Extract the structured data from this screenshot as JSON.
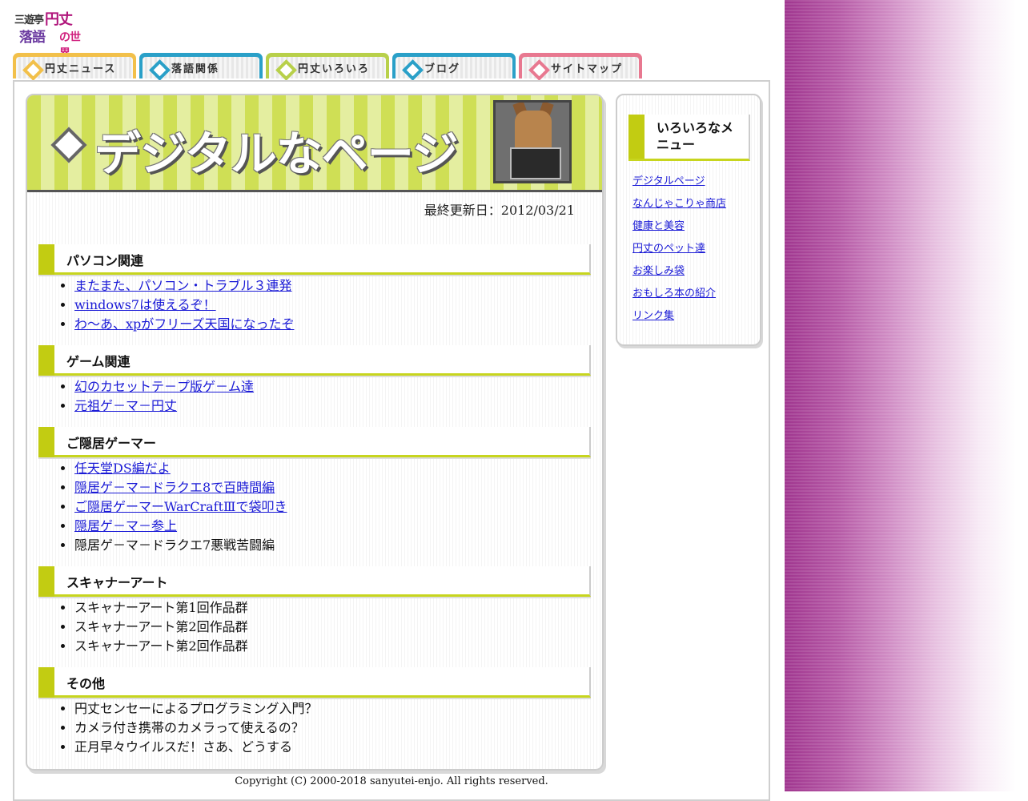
{
  "logo": {
    "line1a": "三遊亭",
    "line1b": "円丈",
    "line2a": "落語",
    "line2b": "の世界"
  },
  "nav": {
    "tabs": [
      {
        "label": "円丈ニュース",
        "color": "#f2c04a"
      },
      {
        "label": "落語関係",
        "color": "#2aa0c8"
      },
      {
        "label": "円丈いろいろ",
        "color": "#b8d04a"
      },
      {
        "label": "ブログ",
        "color": "#2aa0c8"
      },
      {
        "label": "サイトマップ",
        "color": "#e87890"
      }
    ]
  },
  "banner": {
    "title": "デジタルなページ"
  },
  "updated": "最終更新日：2012/03/21",
  "sections": [
    {
      "title": "パソコン関連",
      "items": [
        {
          "text": "またまた、パソコン・トラブル３連発",
          "link": true
        },
        {
          "text": "windows7は使えるぞ！",
          "link": true
        },
        {
          "text": "わ～あ、xpがフリーズ天国になったぞ",
          "link": true
        }
      ]
    },
    {
      "title": "ゲーム関連",
      "items": [
        {
          "text": "幻のカセットテ－プ版ゲ－ム達",
          "link": true
        },
        {
          "text": "元祖ゲ－マ－円丈",
          "link": true
        }
      ]
    },
    {
      "title": "ご隠居ゲーマー",
      "items": [
        {
          "text": "任天堂DS編だよ",
          "link": true
        },
        {
          "text": "隠居ゲ－マ－ドラクエ8で百時間編",
          "link": true
        },
        {
          "text": "ご隠居ゲーマーWarCraftⅢで袋叩き",
          "link": true
        },
        {
          "text": "隠居ゲ－マ－参上",
          "link": true
        },
        {
          "text": "隠居ゲ－マ－ドラクエ7悪戦苦闘編",
          "link": false
        }
      ]
    },
    {
      "title": "スキャナーアート",
      "items": [
        {
          "text": "スキャナーアート第1回作品群",
          "link": false
        },
        {
          "text": "スキャナーアート第2回作品群",
          "link": false
        },
        {
          "text": "スキャナーアート第2回作品群",
          "link": false
        }
      ]
    },
    {
      "title": "その他",
      "items": [
        {
          "text": "円丈センセーによるプログラミング入門？",
          "link": false
        },
        {
          "text": "カメラ付き携帯のカメラって使えるの？",
          "link": false
        },
        {
          "text": "正月早々ウイルスだ！さあ、どうする",
          "link": false
        }
      ]
    }
  ],
  "side": {
    "title": "いろいろなメニュー",
    "links": [
      "デジタルページ",
      "なんじゃこりゃ商店",
      "健康と美容",
      "円丈のペット達",
      "お楽しみ袋",
      "おもしろ本の紹介",
      "リンク集"
    ]
  },
  "footer": {
    "copyright": "Copyright (C) 2000-2018 sanyutei-enjo. All rights reserved."
  },
  "colors": {
    "accent": "#c2cc12",
    "link": "#1a1ad6",
    "strip_purple": "#a0368f"
  }
}
